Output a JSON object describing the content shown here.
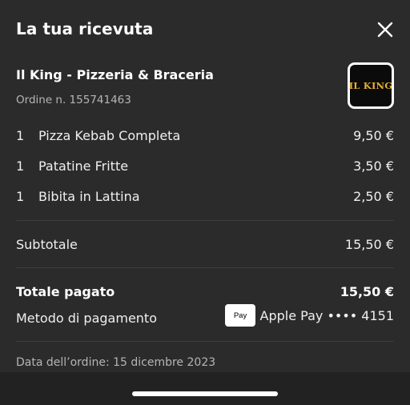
{
  "header": {
    "title": "La tua ricevuta",
    "close_icon": "close-icon"
  },
  "restaurant": {
    "name": "Il King - Pizzeria & Braceria",
    "order_number": "Ordine n. 155741463",
    "logo_text": "IL KING",
    "logo_accent_color": "#e6b030"
  },
  "items": [
    {
      "qty": "1",
      "name": "Pizza Kebab Completa",
      "price": "9,50 €"
    },
    {
      "qty": "1",
      "name": "Patatine Fritte",
      "price": "3,50 €"
    },
    {
      "qty": "1",
      "name": "Bibita in Lattina",
      "price": "2,50 €"
    }
  ],
  "subtotal": {
    "label": "Subtotale",
    "value": "15,50 €"
  },
  "total": {
    "label": "Totale pagato",
    "value": "15,50 €"
  },
  "payment": {
    "label": "Metodo di pagamento",
    "badge_symbol": "",
    "badge_text": "Pay",
    "method": "Apple Pay •••• 4151"
  },
  "order_date": "Data dell’ordine: 15 dicembre 2023",
  "colors": {
    "background": "#2b2b2b",
    "text": "#efefef",
    "muted_text": "#b5b5b5",
    "divider": "#3d3d3d"
  }
}
